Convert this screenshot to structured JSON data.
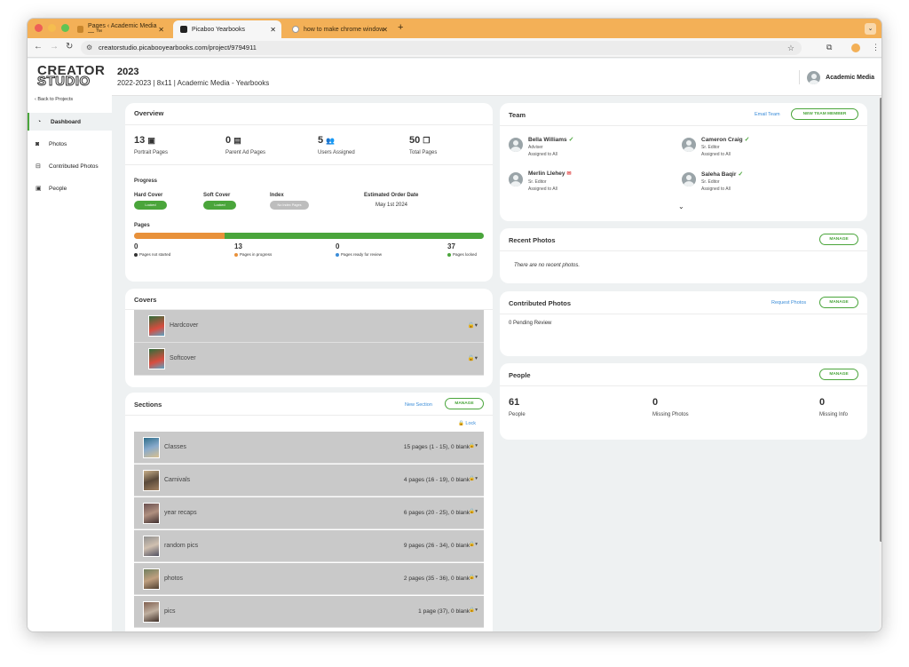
{
  "browser": {
    "tabs": [
      {
        "title": "Pages ‹ Academic Media — ™",
        "active": false
      },
      {
        "title": "Picaboo Yearbooks",
        "active": true
      },
      {
        "title": "how to make chrome window",
        "active": false
      }
    ],
    "url": "creatorstudio.picabooyearbooks.com/project/9794911",
    "colors": {
      "tabstrip": "#f3b057"
    }
  },
  "sidebar": {
    "logo_line1": "CREATOR",
    "logo_line2": "STUDIO",
    "back_label": "Back to Projects",
    "items": [
      {
        "label": "Dashboard",
        "icon": "dashboard-icon",
        "active": true
      },
      {
        "label": "Photos",
        "icon": "camera-icon",
        "active": false
      },
      {
        "label": "Contributed Photos",
        "icon": "inbox-icon",
        "active": false
      },
      {
        "label": "People",
        "icon": "person-icon",
        "active": false
      }
    ]
  },
  "header": {
    "year": "2023",
    "subtitle": "2022-2023 | 8x11 | Academic Media - Yearbooks",
    "account_name": "Academic Media"
  },
  "overview": {
    "title": "Overview",
    "stats": [
      {
        "value": "13",
        "label": "Portrait Pages",
        "icon": "portrait-icon"
      },
      {
        "value": "0",
        "label": "Parent Ad Pages",
        "icon": "image-icon"
      },
      {
        "value": "5",
        "label": "Users Assigned",
        "icon": "users-icon"
      },
      {
        "value": "50",
        "label": "Total Pages",
        "icon": "pages-icon"
      }
    ],
    "progress_label": "Progress",
    "progress_items": [
      {
        "label": "Hard Cover",
        "status": "Locked"
      },
      {
        "label": "Soft Cover",
        "status": "Locked"
      },
      {
        "label": "Index",
        "status": "No Index Pages"
      }
    ],
    "order_date_label": "Estimated Order Date",
    "order_date": "May 1st 2024",
    "pages_label": "Pages",
    "pages_breakdown": [
      {
        "value": "0",
        "label": "Pages not started",
        "color": "#333333"
      },
      {
        "value": "13",
        "label": "Pages in progress",
        "color": "#e8913a"
      },
      {
        "value": "0",
        "label": "Pages ready for review",
        "color": "#3a8cd8"
      },
      {
        "value": "37",
        "label": "Pages locked",
        "color": "#4aa53b"
      }
    ],
    "pages_total": 50
  },
  "covers": {
    "title": "Covers",
    "items": [
      {
        "name": "Hardcover"
      },
      {
        "name": "Softcover"
      }
    ]
  },
  "sections": {
    "title": "Sections",
    "new_section": "New Section",
    "manage": "MANAGE",
    "lock": "Lock",
    "items": [
      {
        "name": "Classes",
        "info": "15 pages (1 - 15), 0 blank"
      },
      {
        "name": "Carnivals",
        "info": "4 pages (16 - 19), 0 blank"
      },
      {
        "name": "year recaps",
        "info": "6 pages (20 - 25), 0 blank"
      },
      {
        "name": "random pics",
        "info": "9 pages (26 - 34), 0 blank"
      },
      {
        "name": "photos",
        "info": "2 pages (35 - 36), 0 blank"
      },
      {
        "name": "pics",
        "info": "1 page (37), 0 blank"
      }
    ]
  },
  "team": {
    "title": "Team",
    "email_team": "Email Team",
    "new_member": "NEW TEAM MEMBER",
    "members": [
      {
        "name": "Bella Williams",
        "role": "Adviser",
        "assigned": "Assigned to All",
        "status": "check"
      },
      {
        "name": "Cameron Craig",
        "role": "Sr. Editor",
        "assigned": "Assigned to All",
        "status": "check"
      },
      {
        "name": "Merlin Llehey",
        "role": "Sr. Editor",
        "assigned": "Assigned to All",
        "status": "mail"
      },
      {
        "name": "Saleha Baqir",
        "role": "Sr. Editor",
        "assigned": "Assigned to All",
        "status": "check"
      }
    ]
  },
  "recent_photos": {
    "title": "Recent Photos",
    "manage": "MANAGE",
    "empty": "There are no recent photos."
  },
  "contributed_photos": {
    "title": "Contributed Photos",
    "request": "Request Photos",
    "manage": "MANAGE",
    "pending": "0 Pending Review"
  },
  "people": {
    "title": "People",
    "manage": "MANAGE",
    "stats": [
      {
        "value": "61",
        "label": "People"
      },
      {
        "value": "0",
        "label": "Missing Photos"
      },
      {
        "value": "0",
        "label": "Missing Info"
      }
    ]
  }
}
